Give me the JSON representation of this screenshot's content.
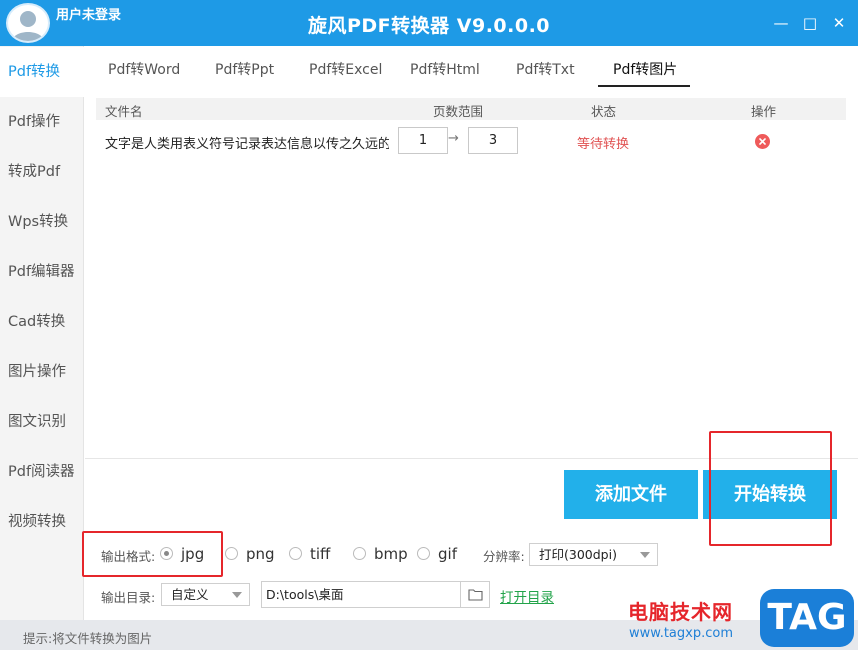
{
  "titlebar": {
    "user_label": "用户未登录",
    "title": "旋风PDF转换器 V9.0.0.0",
    "min_glyph": "—",
    "max_glyph": "□",
    "close_glyph": "✕"
  },
  "sidebar": {
    "items": [
      "Pdf转换",
      "Pdf操作",
      "转成Pdf",
      "Wps转换",
      "Pdf编辑器",
      "Cad转换",
      "图片操作",
      "图文识别",
      "Pdf阅读器",
      "视频转换"
    ],
    "active_index": 0
  },
  "tabs": {
    "items": [
      "Pdf转Word",
      "Pdf转Ppt",
      "Pdf转Excel",
      "Pdf转Html",
      "Pdf转Txt",
      "Pdf转图片"
    ],
    "active_index": 5
  },
  "table": {
    "headers": {
      "filename": "文件名",
      "page_range": "页数范围",
      "status": "状态",
      "action": "操作"
    },
    "rows": [
      {
        "filename": "文字是人类用表义符号记录表达信息以传之久远的",
        "from": "1",
        "arrow": "→",
        "to": "3",
        "status": "等待转换"
      }
    ]
  },
  "buttons": {
    "add_file": "添加文件",
    "start": "开始转换"
  },
  "options": {
    "format_label": "输出格式:",
    "formats": [
      "jpg",
      "png",
      "tiff",
      "bmp",
      "gif"
    ],
    "selected_format": "jpg",
    "resolution_label": "分辨率:",
    "resolution_value": "打印(300dpi)",
    "dir_label": "输出目录:",
    "dir_mode": "自定义",
    "dir_path": "D:\\tools\\桌面",
    "open_dir": "打开目录"
  },
  "statusbar": {
    "text": "提示:将文件转换为图片"
  },
  "watermark": {
    "site_name": "电脑技术网",
    "url": "www.tagxp.com",
    "tag": "TAG"
  },
  "colors": {
    "accent": "#1e9ae6",
    "button": "#22b0ea",
    "status_wait": "#e05252",
    "highlight": "#e5262b",
    "link": "#22a34a"
  }
}
